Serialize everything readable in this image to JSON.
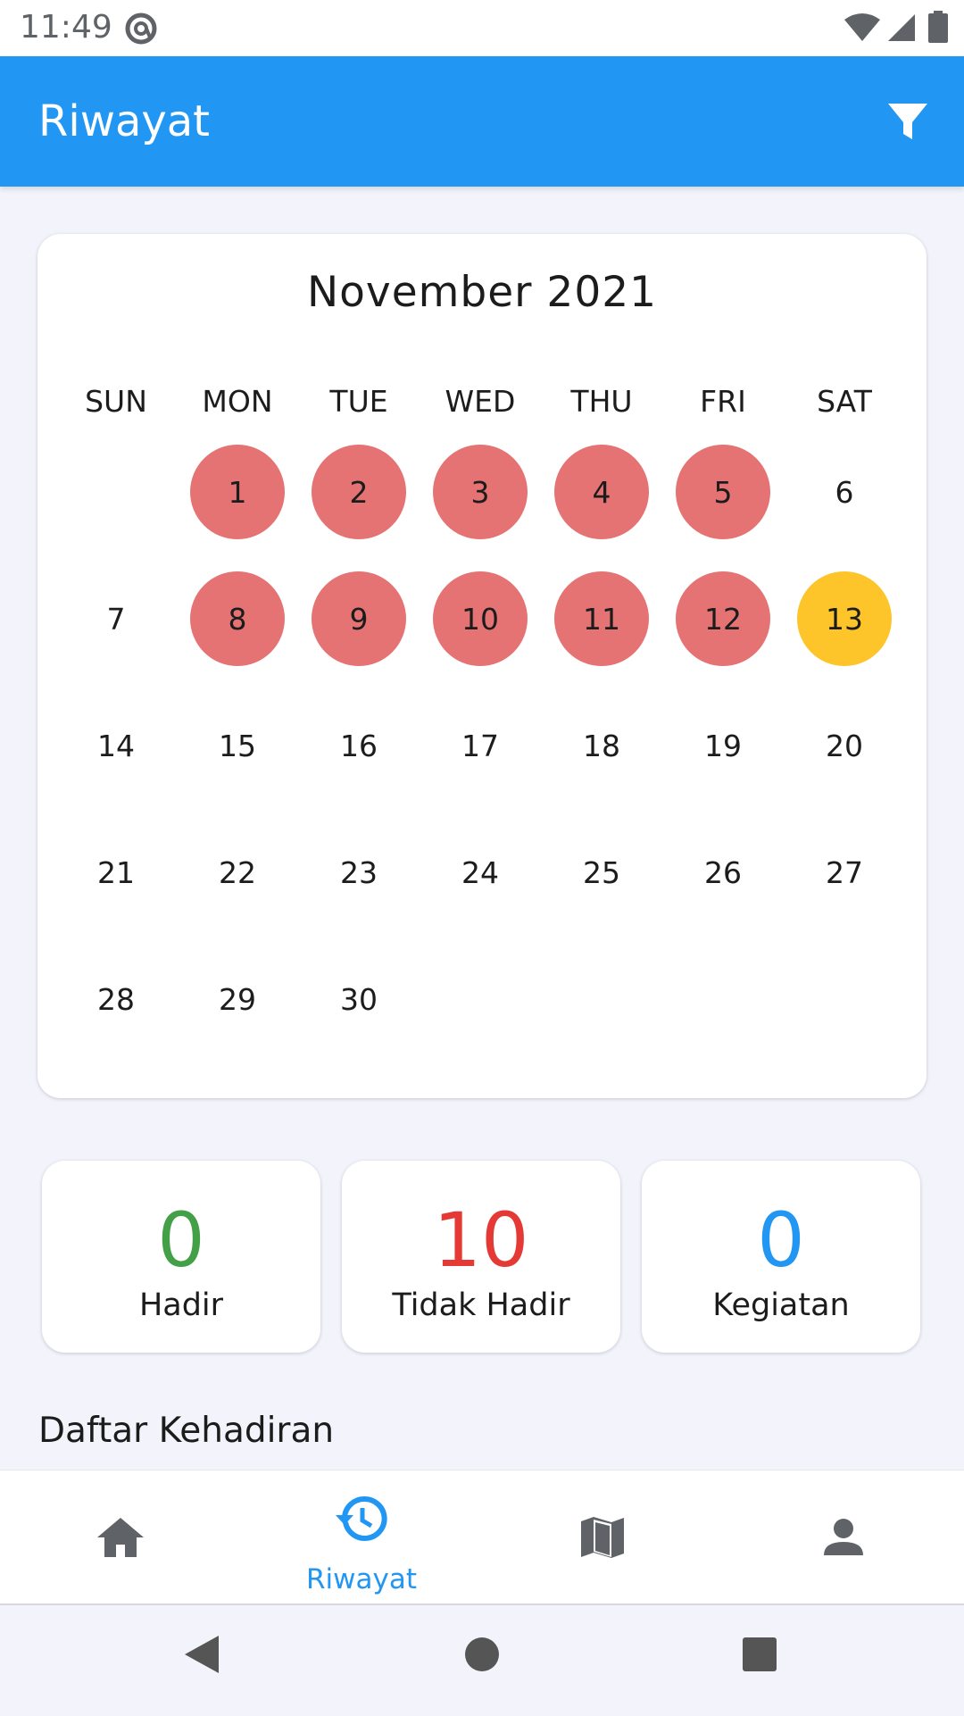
{
  "status_bar": {
    "time": "11:49"
  },
  "app_bar": {
    "title": "Riwayat",
    "filter_icon": "filter-icon"
  },
  "calendar": {
    "month_label": "November 2021",
    "weekdays": [
      "SUN",
      "MON",
      "TUE",
      "WED",
      "THU",
      "FRI",
      "SAT"
    ],
    "first_weekday_index": 1,
    "days_in_month": 30,
    "absent_days": [
      1,
      2,
      3,
      4,
      5,
      8,
      9,
      10,
      11,
      12
    ],
    "today": 13,
    "colors": {
      "absent": "#e57373",
      "today": "#fdc52a"
    }
  },
  "stats": [
    {
      "value": "0",
      "label": "Hadir",
      "color": "#43a047"
    },
    {
      "value": "10",
      "label": "Tidak Hadir",
      "color": "#e53935"
    },
    {
      "value": "0",
      "label": "Kegiatan",
      "color": "#2196f3"
    }
  ],
  "list_section": {
    "title": "Daftar Kehadiran"
  },
  "bottom_nav": {
    "items": [
      {
        "icon": "home-icon",
        "label": ""
      },
      {
        "icon": "history-icon",
        "label": "Riwayat",
        "active": true
      },
      {
        "icon": "map-icon",
        "label": ""
      },
      {
        "icon": "person-icon",
        "label": ""
      }
    ],
    "active_color": "#2196f3",
    "inactive_color": "#5f6368"
  },
  "accent_color": "#2196f3"
}
